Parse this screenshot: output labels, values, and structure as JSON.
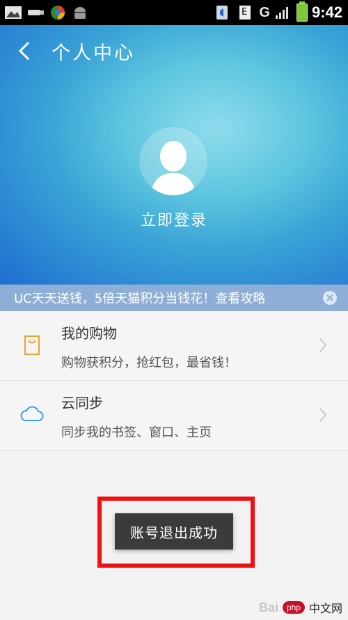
{
  "status_bar": {
    "time": "9:42",
    "network_label": "G",
    "icons": [
      "image-icon",
      "usb-icon",
      "browser-icon",
      "android-icon",
      "sim-call-icon",
      "data-e-icon",
      "signal-icon",
      "battery-icon"
    ]
  },
  "header": {
    "title": "个人中心"
  },
  "profile": {
    "login_label": "立即登录"
  },
  "promo": {
    "text": "UC天天送钱，5倍天猫积分当钱花！查看攻略"
  },
  "list": [
    {
      "title": "我的购物",
      "subtitle": "购物获积分，抢红包，最省钱！",
      "icon": "shopping-bag-icon"
    },
    {
      "title": "云同步",
      "subtitle": "同步我的书签、窗口、主页",
      "icon": "cloud-icon"
    }
  ],
  "toast": {
    "text": "账号退出成功"
  },
  "watermark": {
    "baidu": "Bai",
    "php": "php",
    "cn": "中文网"
  },
  "colors": {
    "hero_top": "#1e6ed0",
    "promo_bg": "#8eaed8",
    "highlight": "#ee1111",
    "bag_icon": "#f0a030",
    "cloud_icon": "#3a9fd6"
  }
}
